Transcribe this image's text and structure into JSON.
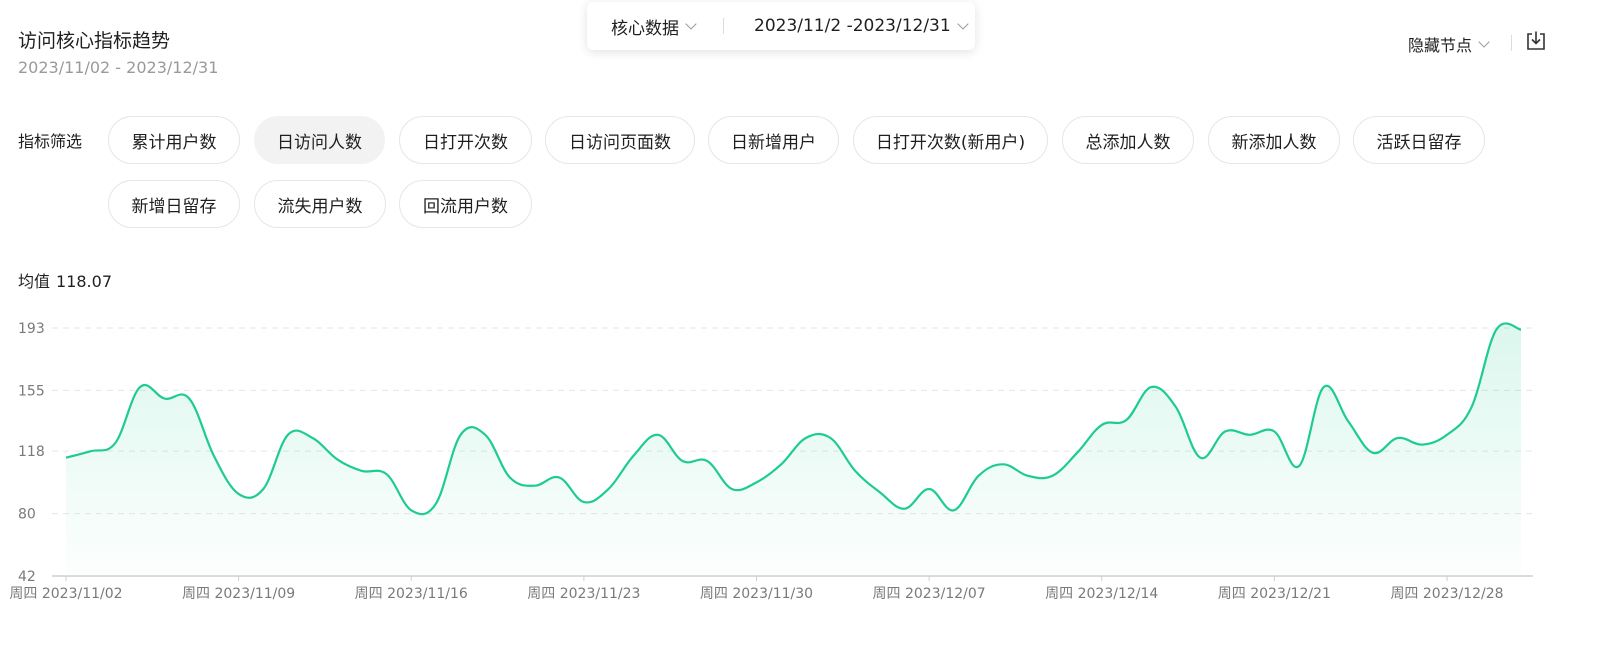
{
  "header": {
    "title": "访问核心指标趋势",
    "subtitle": "2023/11/02 - 2023/12/31"
  },
  "selector": {
    "type_label": "核心数据",
    "date_range": "2023/11/2 -2023/12/31"
  },
  "toolbar": {
    "hide_nodes_label": "隐藏节点"
  },
  "filters": {
    "label": "指标筛选",
    "chips": [
      "累计用户数",
      "日访问人数",
      "日打开次数",
      "日访问页面数",
      "日新增用户",
      "日打开次数(新用户)",
      "总添加人数",
      "新添加人数",
      "活跃日留存",
      "新增日留存",
      "流失用户数",
      "回流用户数"
    ],
    "active": "日访问人数"
  },
  "summary": {
    "mean_label": "均值",
    "mean_value": "118.07"
  },
  "chart_data": {
    "type": "area",
    "color": "#1fcc8f",
    "grid": true,
    "ylim": [
      42,
      193
    ],
    "yticks": [
      "193",
      "155",
      "118",
      "80",
      "42"
    ],
    "xtick_labels": [
      "周四 2023/11/02",
      "周四 2023/11/09",
      "周四 2023/11/16",
      "周四 2023/11/23",
      "周四 2023/11/30",
      "周四 2023/12/07",
      "周四 2023/12/14",
      "周四 2023/12/21",
      "周四 2023/12/28"
    ],
    "x": [
      "2023/11/02",
      "2023/11/03",
      "2023/11/04",
      "2023/11/05",
      "2023/11/06",
      "2023/11/07",
      "2023/11/08",
      "2023/11/09",
      "2023/11/10",
      "2023/11/11",
      "2023/11/12",
      "2023/11/13",
      "2023/11/14",
      "2023/11/15",
      "2023/11/16",
      "2023/11/17",
      "2023/11/18",
      "2023/11/19",
      "2023/11/20",
      "2023/11/21",
      "2023/11/22",
      "2023/11/23",
      "2023/11/24",
      "2023/11/25",
      "2023/11/26",
      "2023/11/27",
      "2023/11/28",
      "2023/11/29",
      "2023/11/30",
      "2023/12/01",
      "2023/12/02",
      "2023/12/03",
      "2023/12/04",
      "2023/12/05",
      "2023/12/06",
      "2023/12/07",
      "2023/12/08",
      "2023/12/09",
      "2023/12/10",
      "2023/12/11",
      "2023/12/12",
      "2023/12/13",
      "2023/12/14",
      "2023/12/15",
      "2023/12/16",
      "2023/12/17",
      "2023/12/18",
      "2023/12/19",
      "2023/12/20",
      "2023/12/21",
      "2023/12/22",
      "2023/12/23",
      "2023/12/24",
      "2023/12/25",
      "2023/12/26",
      "2023/12/27",
      "2023/12/28",
      "2023/12/29",
      "2023/12/30",
      "2023/12/31"
    ],
    "values": [
      114,
      118,
      123,
      157,
      150,
      150,
      115,
      92,
      95,
      128,
      126,
      113,
      106,
      104,
      82,
      86,
      128,
      128,
      102,
      97,
      102,
      87,
      95,
      115,
      128,
      112,
      112,
      95,
      99,
      110,
      126,
      126,
      106,
      93,
      83,
      95,
      82,
      103,
      110,
      103,
      103,
      117,
      134,
      137,
      157,
      145,
      114,
      130,
      128,
      130,
      109,
      157,
      136,
      117,
      126,
      122,
      128,
      145,
      192,
      192
    ]
  }
}
